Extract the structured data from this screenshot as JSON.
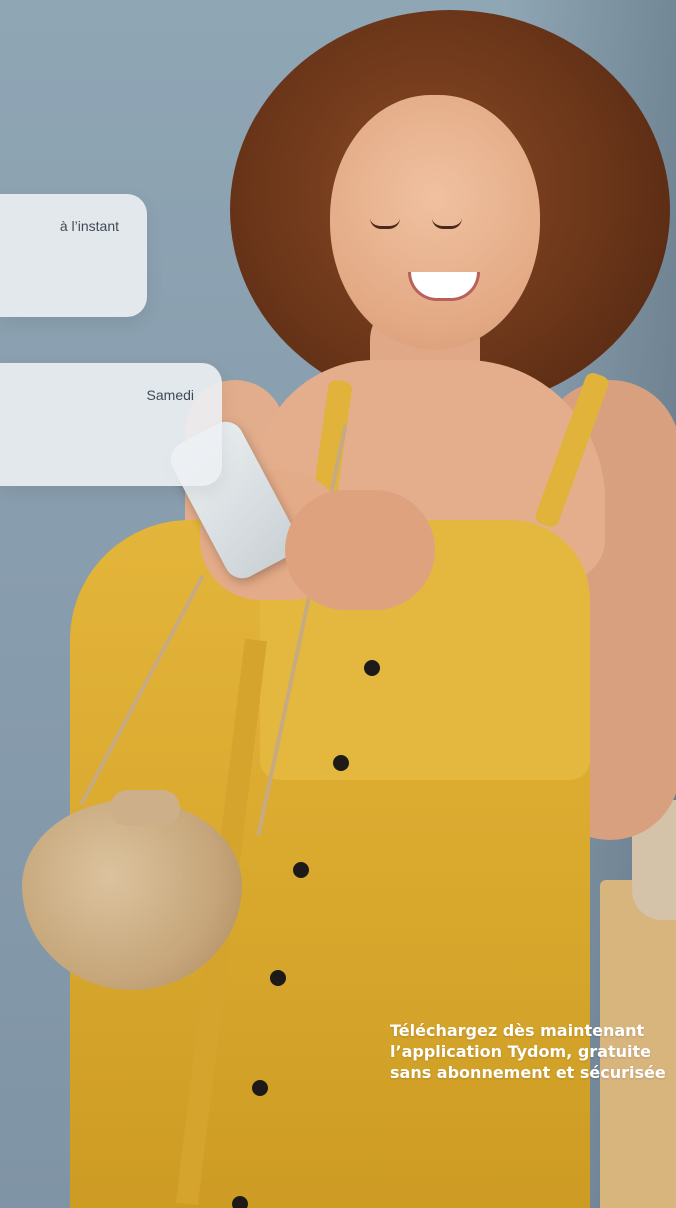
{
  "notifications": [
    {
      "time": "à l’instant"
    },
    {
      "time": "Samedi"
    }
  ],
  "promo": {
    "lines": [
      "Téléchargez dès maintenant",
      "l’application Tydom, gratuite",
      "sans abonnement et sécurisée"
    ]
  }
}
